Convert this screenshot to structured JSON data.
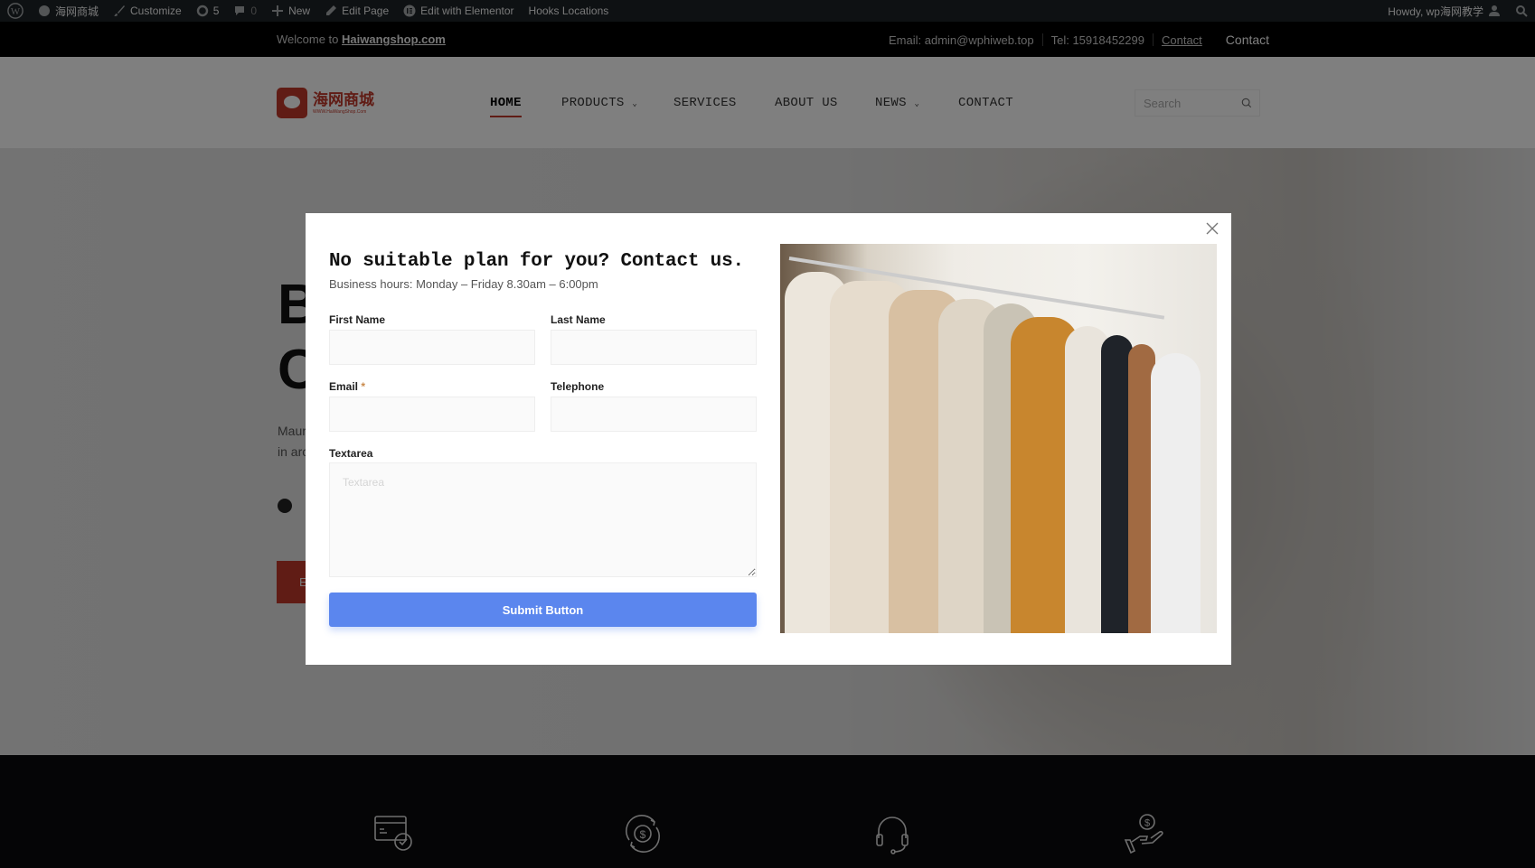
{
  "admin_bar": {
    "items": [
      {
        "icon": "wordpress-icon",
        "label": ""
      },
      {
        "icon": "dashboard-icon",
        "label": "海网商城"
      },
      {
        "icon": "brush-icon",
        "label": "Customize"
      },
      {
        "icon": "updates-icon",
        "label": "5"
      },
      {
        "icon": "comment-icon",
        "label": "0"
      },
      {
        "icon": "plus-icon",
        "label": "New"
      },
      {
        "icon": "pencil-icon",
        "label": "Edit Page"
      },
      {
        "icon": "elementor-icon",
        "label": "Edit with Elementor"
      },
      {
        "icon": "",
        "label": "Hooks Locations"
      }
    ],
    "howdy": "Howdy, wp海网教学"
  },
  "topbar": {
    "welcome": "Welcome to ",
    "site_link": "Haiwangshop.com",
    "email": "Email: admin@wphiweb.top",
    "tel": "Tel: 15918452299",
    "contact_link": "Contact",
    "contact": "Contact"
  },
  "header": {
    "logo_text": "海网商城",
    "logo_sub": "WWW.HaiWangShop.Com",
    "nav": [
      {
        "label": "HOME",
        "active": true
      },
      {
        "label": "PRODUCTS",
        "dropdown": true
      },
      {
        "label": "SERVICES"
      },
      {
        "label": "ABOUT US"
      },
      {
        "label": "NEWS",
        "dropdown": true
      },
      {
        "label": "CONTACT"
      }
    ],
    "search_placeholder": "Search"
  },
  "hero": {
    "line1": "B",
    "line2": "C",
    "para1": "Maur",
    "para2": "in arc",
    "button": "E"
  },
  "footer": {
    "icons": [
      "card-check-icon",
      "dollar-refresh-icon",
      "headset-icon",
      "hand-dollar-icon"
    ]
  },
  "modal": {
    "title": "No suitable plan for you? Contact us.",
    "subtitle": "Business hours: Monday – Friday 8.30am – 6:00pm",
    "fields": {
      "first_name": "First Name",
      "last_name": "Last Name",
      "email": "Email",
      "email_required": "*",
      "telephone": "Telephone",
      "textarea": "Textarea",
      "textarea_placeholder": "Textarea"
    },
    "submit": "Submit Button"
  },
  "colors": {
    "accent": "#c0392b",
    "submit": "#5b86ee",
    "admin_bar": "#1d2327"
  }
}
